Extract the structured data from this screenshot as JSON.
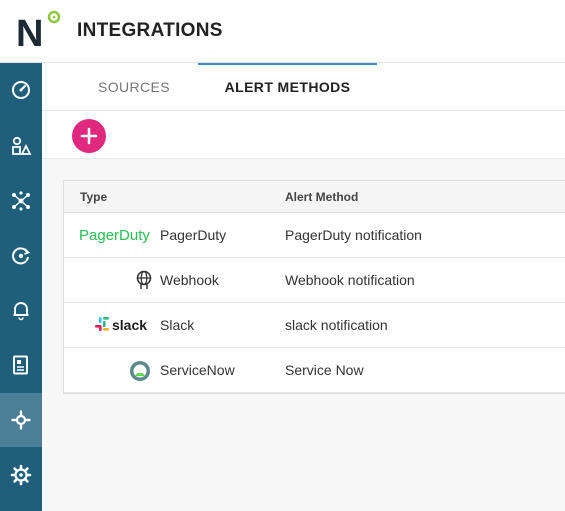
{
  "header": {
    "title": "INTEGRATIONS",
    "logo_letter": "N"
  },
  "sidebar": {
    "items": [
      {
        "name": "dashboard",
        "icon": "speedometer-icon"
      },
      {
        "name": "topology",
        "icon": "shapes-icon"
      },
      {
        "name": "network",
        "icon": "network-nodes-icon"
      },
      {
        "name": "monitoring",
        "icon": "refresh-target-icon"
      },
      {
        "name": "alerts",
        "icon": "bell-icon"
      },
      {
        "name": "reports",
        "icon": "report-icon"
      },
      {
        "name": "integrations",
        "icon": "integration-gear-icon",
        "active": true
      },
      {
        "name": "settings",
        "icon": "gear-icon"
      }
    ]
  },
  "tabs": {
    "sources": "SOURCES",
    "alert_methods": "ALERT METHODS"
  },
  "toolbar": {
    "add_icon": "plus-icon"
  },
  "table": {
    "headers": {
      "type": "Type",
      "alert_method": "Alert Method"
    },
    "rows": [
      {
        "type": "PagerDuty",
        "method": "PagerDuty notification",
        "logo_text": "PagerDuty",
        "icon": "pagerduty-logo"
      },
      {
        "type": "Webhook",
        "method": "Webhook notification",
        "icon": "webhook-icon"
      },
      {
        "type": "Slack",
        "method": "slack notification",
        "logo_text": "slack",
        "icon": "slack-logo"
      },
      {
        "type": "ServiceNow",
        "method": "Service Now",
        "icon": "servicenow-logo"
      }
    ]
  },
  "colors": {
    "sidebar": "#1f5f7c",
    "sidebar_active": "#4b7f98",
    "accent_add": "#e0287f",
    "tab_underline": "#3b8fc7",
    "logo_green": "#8dc63f",
    "pagerduty_green": "#25c151",
    "servicenow_green": "#62d84e"
  }
}
